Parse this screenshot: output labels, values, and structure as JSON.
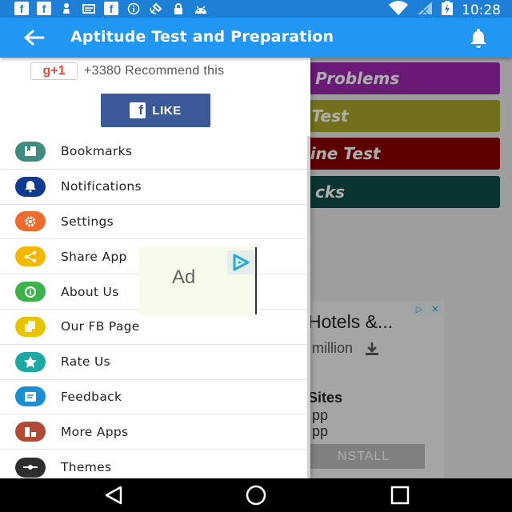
{
  "status_bar": {
    "time": "10:28",
    "left_icons": [
      "facebook-icon",
      "facebook-icon",
      "chess-pawn-icon",
      "cast-icon",
      "facebook-icon",
      "info-icon",
      "satellite-icon",
      "lock-icon",
      "android-icon"
    ],
    "right_icons": [
      "wifi-icon",
      "signal-icon",
      "battery-charging-icon"
    ]
  },
  "app_bar": {
    "title": "Aptitude Test and Preparation",
    "color": "#2196f3"
  },
  "drawer": {
    "gplus": {
      "button_label": "g+1",
      "count_text": "+3380 Recommend this"
    },
    "fb_like": {
      "icon_label": "f",
      "label": "LIKE"
    },
    "items": [
      {
        "label": "Bookmarks",
        "icon": "bookmark-icon",
        "color": "#3d8c7e"
      },
      {
        "label": "Notifications",
        "icon": "bell-icon",
        "color": "#0d3b91"
      },
      {
        "label": "Settings",
        "icon": "gear-icon",
        "color": "#ef6c2e"
      },
      {
        "label": "Share App",
        "icon": "share-icon",
        "color": "#f5b800"
      },
      {
        "label": "About Us",
        "icon": "info-icon",
        "color": "#3bb34a"
      },
      {
        "label": "Our FB Page",
        "icon": "pages-icon",
        "color": "#e6c400"
      },
      {
        "label": "Rate Us",
        "icon": "star-icon",
        "color": "#1ea8a4"
      },
      {
        "label": "Feedback",
        "icon": "feedback-icon",
        "color": "#1a8fd6"
      },
      {
        "label": "More Apps",
        "icon": "apps-icon",
        "color": "#b24a35"
      },
      {
        "label": "Themes",
        "icon": "theme-icon",
        "color": "#2d2d2d"
      }
    ]
  },
  "background": {
    "buttons": [
      {
        "label": "olved Problems",
        "color": "#9c27b0"
      },
      {
        "label": "Test",
        "color": "#aaa52a"
      },
      {
        "label": "Online Test",
        "color": "#8b0000"
      },
      {
        "label": "cks",
        "color": "#0e4d4a"
      }
    ],
    "ad": {
      "headline": "Hotels &...",
      "subline": "million",
      "section": "Sites",
      "line1": "pp",
      "line2": "pp",
      "install": "NSTALL"
    }
  },
  "floating_ad": {
    "label": "Ad"
  },
  "nav_bar": {
    "icons": [
      "back-triangle-icon",
      "home-circle-icon",
      "recents-square-icon"
    ]
  }
}
